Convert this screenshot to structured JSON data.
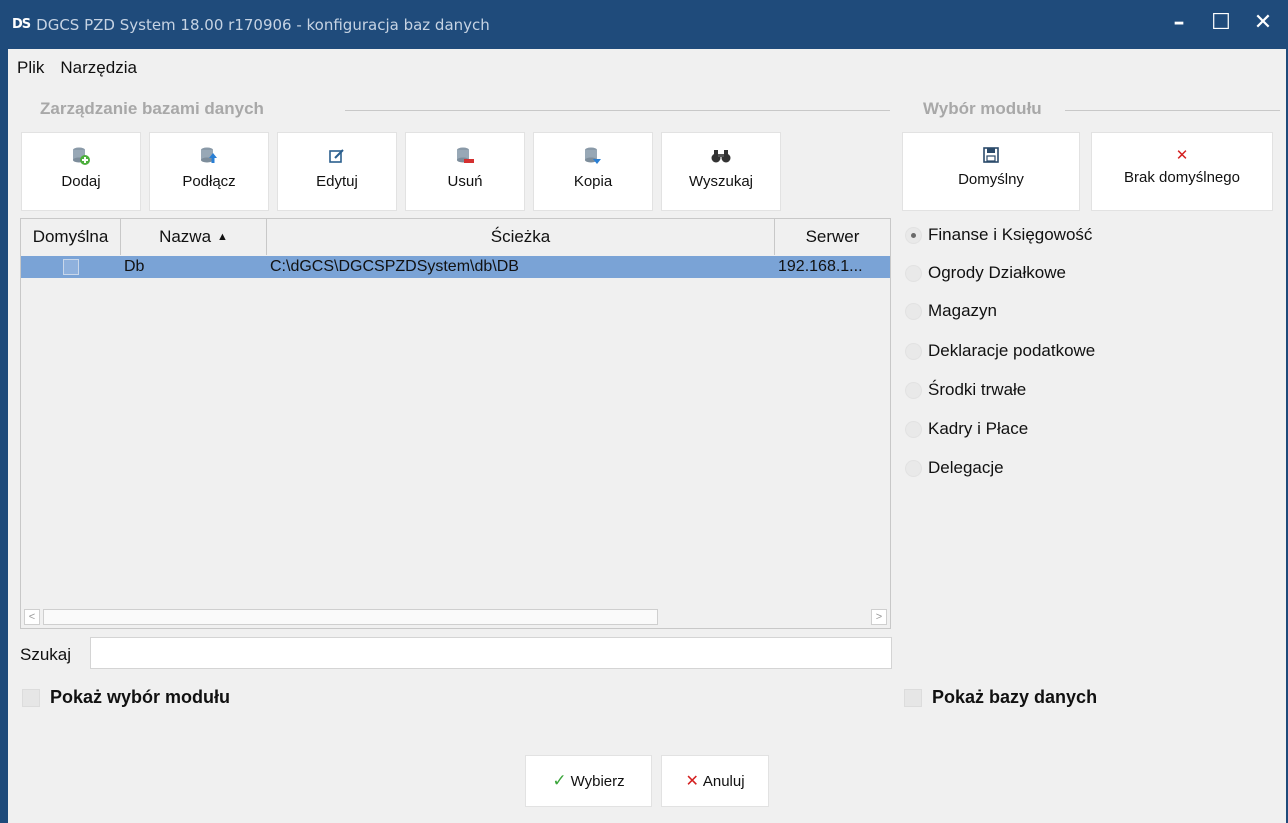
{
  "window": {
    "logo": "DS",
    "title": "DGCS PZD System 18.00 r170906 - konfiguracja baz danych",
    "minimize": "–",
    "maximize": "☐",
    "close": "✕"
  },
  "menu": {
    "items": [
      "Plik",
      "Narzędzia"
    ]
  },
  "db_group": {
    "title": "Zarządzanie bazami danych",
    "buttons": [
      {
        "label": "Dodaj",
        "icon": "database-add-icon"
      },
      {
        "label": "Podłącz",
        "icon": "database-connect-icon"
      },
      {
        "label": "Edytuj",
        "icon": "edit-icon"
      },
      {
        "label": "Usuń",
        "icon": "database-remove-icon"
      },
      {
        "label": "Kopia",
        "icon": "database-backup-icon"
      },
      {
        "label": "Wyszukaj",
        "icon": "binoculars-icon"
      }
    ]
  },
  "grid": {
    "columns": [
      "Domyślna",
      "Nazwa",
      "Ścieżka",
      "Serwer"
    ],
    "sort_indicator": "▲",
    "rows": [
      {
        "default": false,
        "name": "Db",
        "path": "C:\\dGCS\\DGCSPZDSystem\\db\\DB",
        "server": "192.168.1..."
      }
    ],
    "scroll_left": "<",
    "scroll_right": ">"
  },
  "search": {
    "label": "Szukaj",
    "value": "",
    "placeholder": ""
  },
  "show_module_choice": {
    "label": "Pokaż wybór modułu",
    "checked": false
  },
  "module_group": {
    "title": "Wybór modułu",
    "buttons": [
      {
        "label": "Domyślny",
        "icon": "save-icon"
      },
      {
        "label": "Brak domyślnego",
        "icon": "clear-icon"
      }
    ],
    "modules": [
      {
        "label": "Finanse i Księgowość",
        "selected": true
      },
      {
        "label": "Ogrody Działkowe",
        "selected": false
      },
      {
        "label": "Magazyn",
        "selected": false
      },
      {
        "label": "Deklaracje podatkowe",
        "selected": false
      },
      {
        "label": "Środki trwałe",
        "selected": false
      },
      {
        "label": "Kadry i Płace",
        "selected": false
      },
      {
        "label": "Delegacje",
        "selected": false
      }
    ]
  },
  "show_databases": {
    "label": "Pokaż bazy danych",
    "checked": false
  },
  "dialog_buttons": {
    "ok": "Wybierz",
    "cancel": "Anuluj"
  },
  "colors": {
    "titlebar": "#1f4b7b",
    "selected_row": "#7aa3d6",
    "ok_icon": "#3aa53a",
    "cancel_icon": "#d42020"
  }
}
